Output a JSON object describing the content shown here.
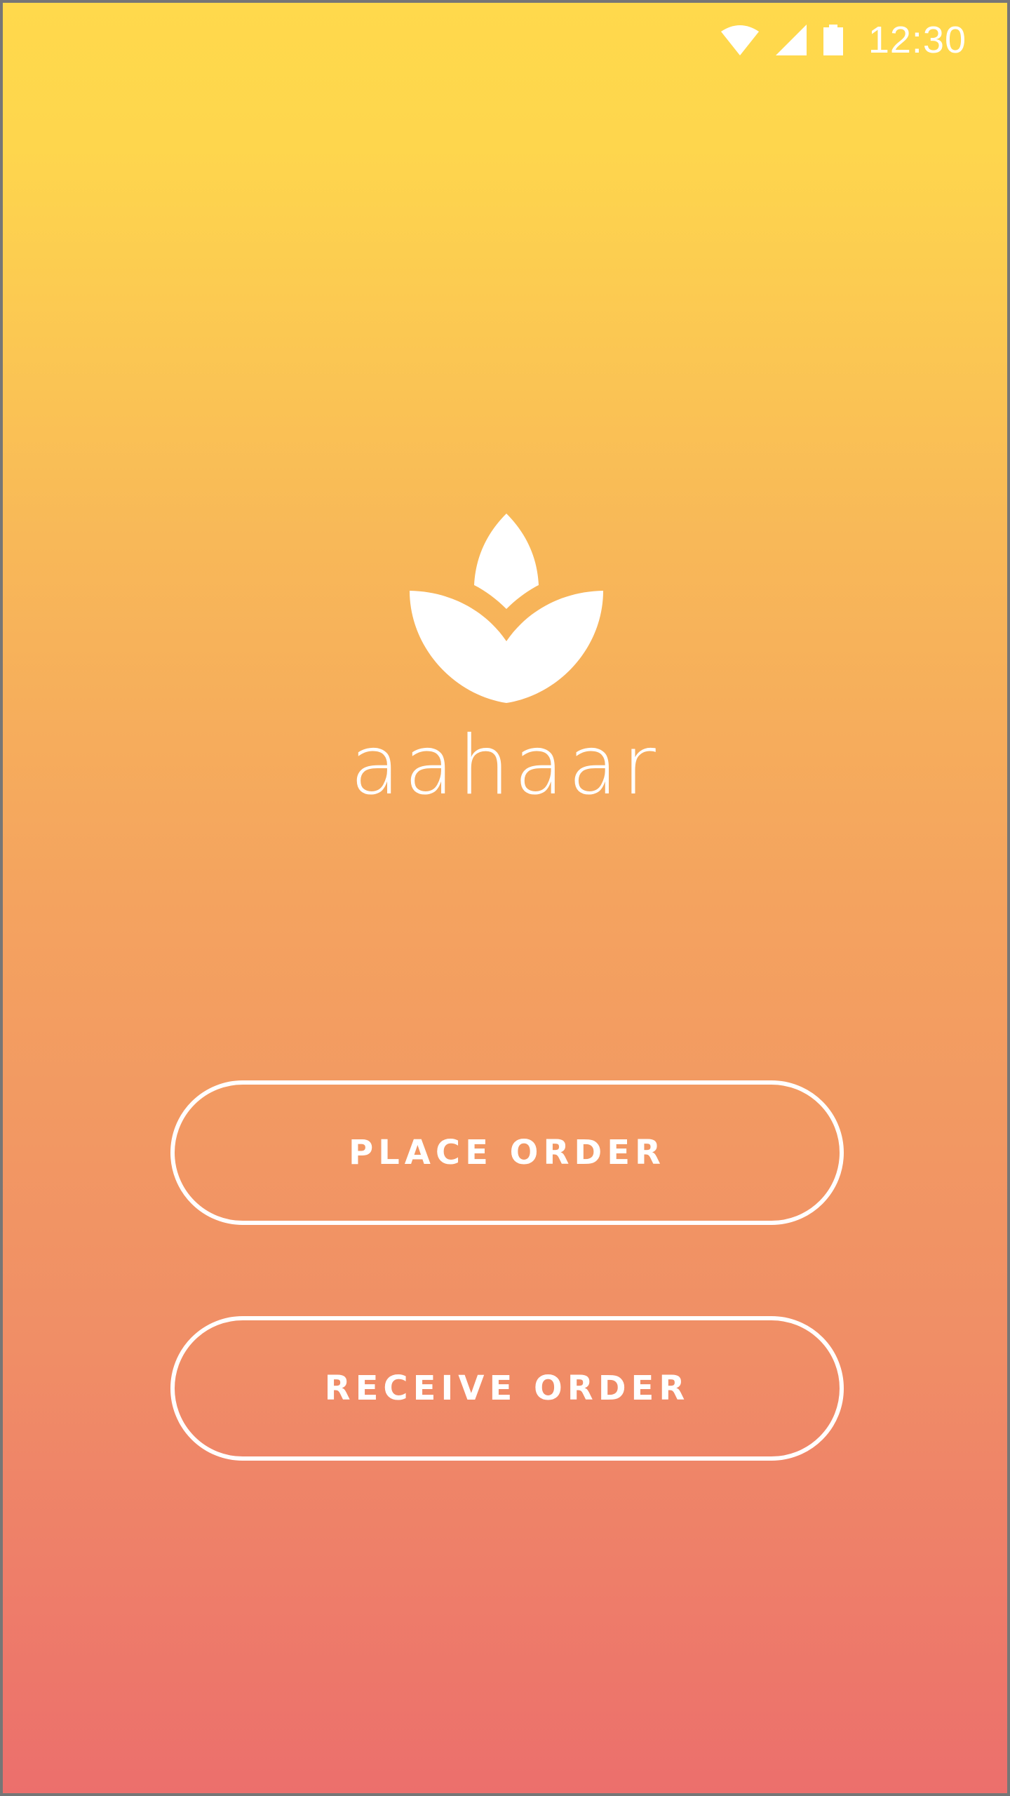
{
  "status_bar": {
    "time": "12:30",
    "icons": [
      "wifi-icon",
      "signal-icon",
      "battery-icon"
    ]
  },
  "app": {
    "name": "aahaar",
    "logo": "lotus-leaf-icon"
  },
  "actions": {
    "place_order_label": "PLACE ORDER",
    "receive_order_label": "RECEIVE ORDER"
  },
  "colors": {
    "gradient_top": "#FFD94C",
    "gradient_bottom": "#EC6F6C",
    "foreground": "#FFFFFF",
    "frame_border": "#767676"
  }
}
